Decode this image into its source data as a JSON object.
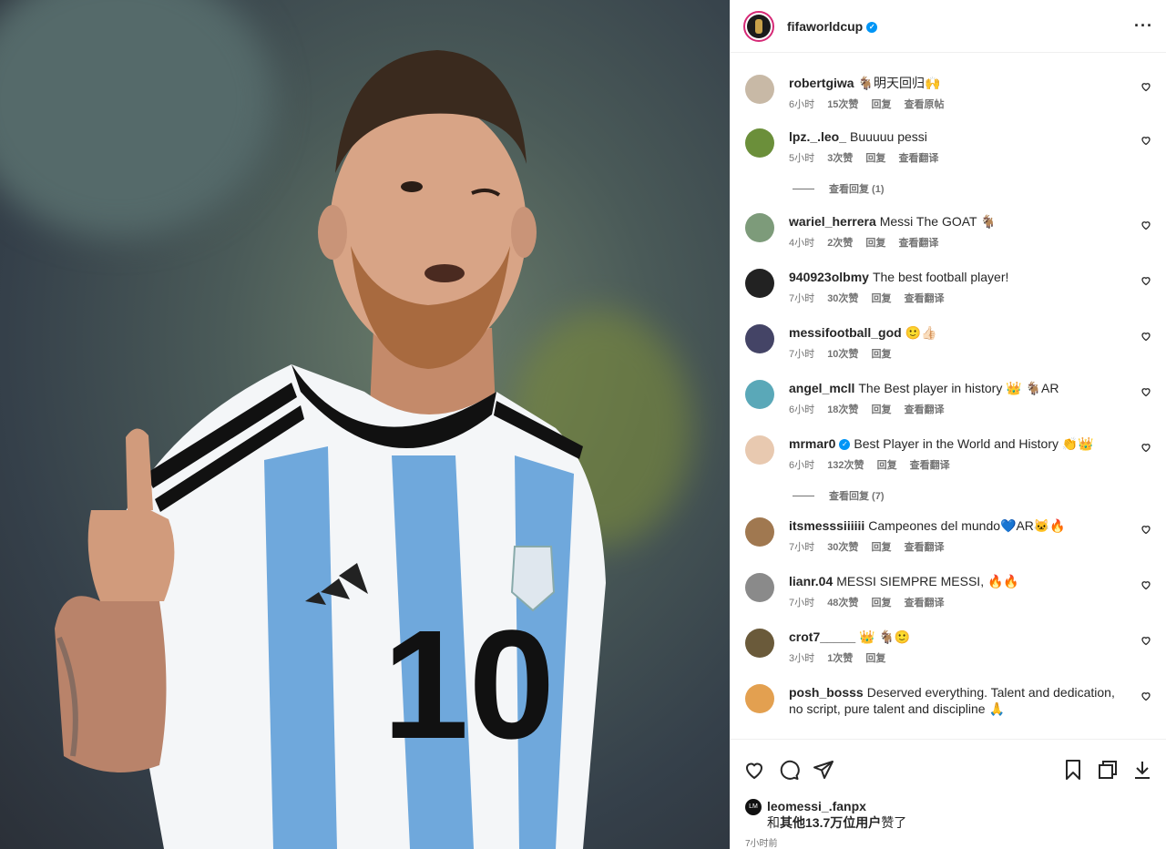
{
  "post": {
    "username": "fifaworldcup",
    "verified": true,
    "more_label": "···"
  },
  "comments": [
    {
      "user": "robertgiwa",
      "text": "🐐明天回归🙌",
      "time": "6小时",
      "likes": "15次赞",
      "reply": "回复",
      "extra": "查看原帖"
    },
    {
      "user": "lpz._.leo_",
      "text": "Buuuuu pessi",
      "time": "5小时",
      "likes": "3次赞",
      "reply": "回复",
      "extra": "查看翻译",
      "view_replies": "查看回复 (1)"
    },
    {
      "user": "wariel_herrera",
      "text": "Messi The GOAT 🐐",
      "time": "4小时",
      "likes": "2次赞",
      "reply": "回复",
      "extra": "查看翻译"
    },
    {
      "user": "940923olbmy",
      "text": "The best football player!",
      "time": "7小时",
      "likes": "30次赞",
      "reply": "回复",
      "extra": "查看翻译"
    },
    {
      "user": "messifootball_god",
      "text": "🙂👍🏻",
      "time": "7小时",
      "likes": "10次赞",
      "reply": "回复",
      "extra": ""
    },
    {
      "user": "angel_mcll",
      "text": "The Best player in history 👑 🐐AR",
      "time": "6小时",
      "likes": "18次赞",
      "reply": "回复",
      "extra": "查看翻译"
    },
    {
      "user": "mrmar0",
      "verified": true,
      "text": "Best Player in the World and History 👏👑",
      "time": "6小时",
      "likes": "132次赞",
      "reply": "回复",
      "extra": "查看翻译",
      "view_replies": "查看回复 (7)"
    },
    {
      "user": "itsmesssiiiiii",
      "text": "Campeones del mundo💙AR🐱🔥",
      "time": "7小时",
      "likes": "30次赞",
      "reply": "回复",
      "extra": "查看翻译"
    },
    {
      "user": "lianr.04",
      "text": "MESSI SIEMPRE MESSI, 🔥🔥",
      "time": "7小时",
      "likes": "48次赞",
      "reply": "回复",
      "extra": "查看翻译"
    },
    {
      "user": "crot7_____",
      "text": "👑 🐐🙂",
      "time": "3小时",
      "likes": "1次赞",
      "reply": "回复",
      "extra": ""
    },
    {
      "user": "posh_bosss",
      "text": "Deserved everything. Talent and dedication, no script, pure talent and discipline 🙏",
      "time": "",
      "likes": "",
      "reply": "",
      "extra": ""
    }
  ],
  "likes": {
    "liker": "leomessi_.fanpx",
    "prefix": "和",
    "others": "其他13.7万位用户",
    "suffix": "赞了",
    "avatar_text": "LM"
  },
  "timestamp": "7小时前",
  "colors": {
    "accent": "#0095f6",
    "ring": "#d62976"
  }
}
